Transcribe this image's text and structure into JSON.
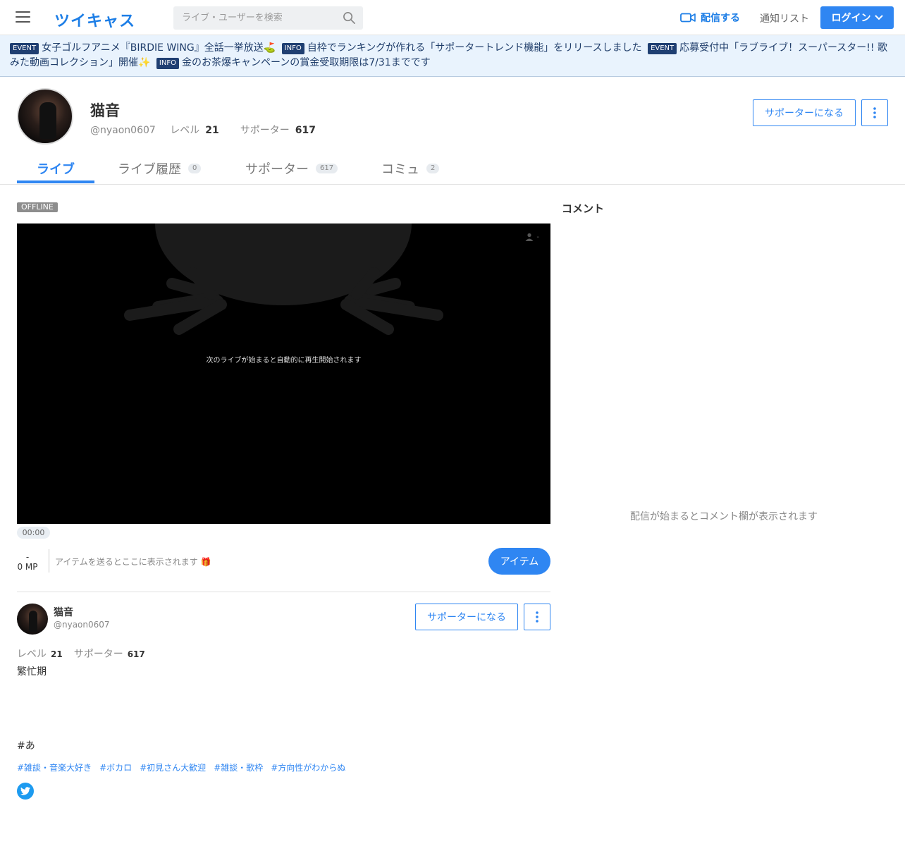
{
  "header": {
    "logo": "ツイキャス",
    "search_placeholder": "ライブ・ユーザーを検索",
    "broadcast_label": "配信する",
    "notification_label": "通知リスト",
    "login_label": "ログイン"
  },
  "news": [
    {
      "tag": "EVENT",
      "text": "女子ゴルフアニメ『BIRDIE WING』全話一挙放送⛳"
    },
    {
      "tag": "INFO",
      "text": "自枠でランキングが作れる「サポータートレンド機能」をリリースしました"
    },
    {
      "tag": "EVENT",
      "text": "応募受付中「ラブライブ！スーパースター!! 歌みた動画コレクション」開催✨"
    },
    {
      "tag": "INFO",
      "text": "金のお茶爆キャンペーンの賞金受取期限は7/31までです"
    }
  ],
  "profile": {
    "name": "猫音",
    "handle": "@nyaon0607",
    "level_label": "レベル",
    "level": "21",
    "supporter_label": "サポーター",
    "supporters": "617",
    "become_supporter": "サポーターになる"
  },
  "tabs": [
    {
      "label": "ライブ",
      "count": null
    },
    {
      "label": "ライブ履歴",
      "count": "0"
    },
    {
      "label": "サポーター",
      "count": "617"
    },
    {
      "label": "コミュ",
      "count": "2"
    }
  ],
  "player": {
    "status": "OFFLINE",
    "message": "次のライブが始まると自動的に再生開始されます",
    "viewer_count": "-",
    "time": "00:00"
  },
  "items": {
    "mp_top": "-",
    "mp_value": "0 MP",
    "placeholder": "アイテムを送るとここに表示されます 🎁",
    "button": "アイテム"
  },
  "bio": {
    "description": "繁忙期",
    "main_tag": "#あ",
    "tags": [
      "#雑談・音楽大好き",
      "#ボカロ",
      "#初見さん大歓迎",
      "#雑談・歌枠",
      "#方向性がわからぬ"
    ]
  },
  "comments": {
    "title": "コメント",
    "empty": "配信が始まるとコメント欄が表示されます"
  },
  "colors": {
    "accent": "#2f86f2",
    "news_bg": "#e9f3fd",
    "tag_bg": "#1f3f72"
  }
}
